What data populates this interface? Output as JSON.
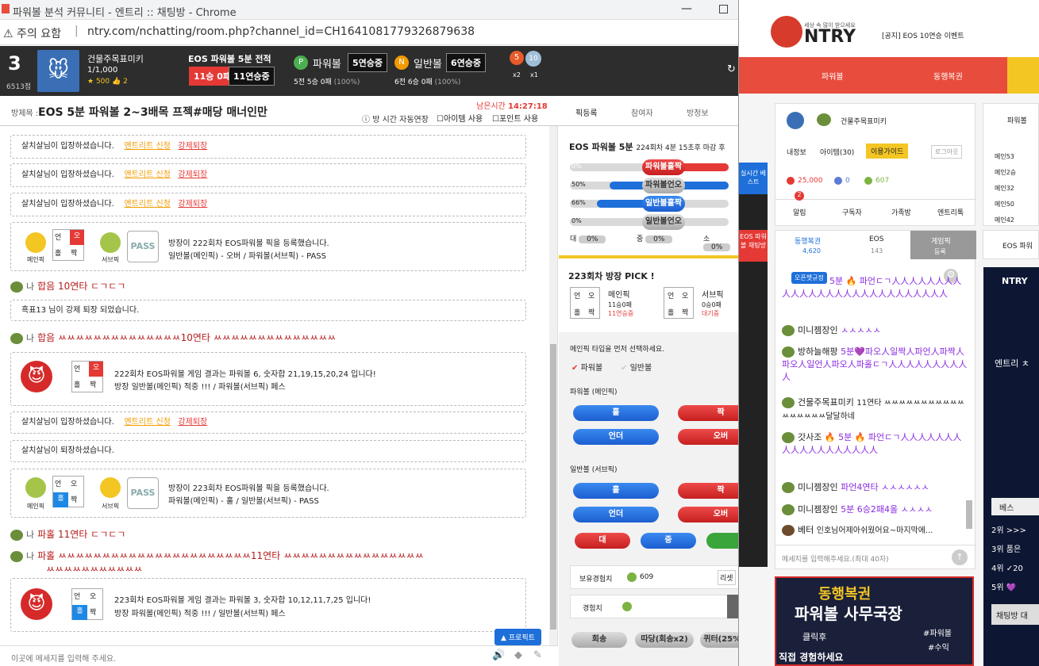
{
  "popup": {
    "window_title": "파워볼 분석 커뮤니티 - 엔트리 :: 채팅방 - Chrome",
    "warning": "주의 요함",
    "url": "ntry.com/nchatting/room.php?channel_id=CH1641081779326879638",
    "level": "3",
    "points": "6513점",
    "nickname": "건물주목표미키",
    "rank": "1/1,000",
    "stars": "500",
    "likes": "2",
    "record_title": "EOS 파워볼 5분 전적",
    "win_loss": "11승 0패",
    "streak": "11연승중",
    "pb_label": "파워볼",
    "pb_streak": "5연승중",
    "pb_sub": "5전 5승 0패",
    "pb_pct": "(100%)",
    "nb_label": "일반볼",
    "nb_streak": "6연승중",
    "nb_sub": "6전 6승 0패",
    "nb_pct": "(100%)",
    "medal1": "5",
    "medal1x": "x2",
    "medal2": "10",
    "medal2x": "x1",
    "room_label": "방제목 :",
    "room_title": "EOS 5분 파워볼 2~3배목 프젝#매당 매너인만",
    "remain_label": "남은시간",
    "remain_time": "14:27:18",
    "auto_ext": "방 시간 자동연장",
    "item_use": "아이템 사용",
    "point_use": "포인트 사용",
    "tabs": [
      "픽등록",
      "참여자",
      "방정보"
    ]
  },
  "chat": {
    "enter": "살치살님이 입장하셨습니다.",
    "entry_apply": "엔트리트 신청",
    "kick": "강제퇴장",
    "pick222": "방장이 222회차 EOS파워볼 픽을 등록했습니다.",
    "pick222_detail": "일반볼(메인픽) - 오버 / 파워볼(서브픽) - PASS",
    "main_pick": "메인픽",
    "sub_pick": "서브픽",
    "pass": "PASS",
    "powerball": "파워볼",
    "normalball": "일반볼",
    "me": "나",
    "msg1": "합음 10연타 ㄷㄱㄷㄱ",
    "kicked": "흑표13 님이 강제 퇴장 되었습니다.",
    "msg2": "합음 ㅆㅆㅆㅆㅆㅆㅆㅆㅆㅆㅆㅆㅆㅆ10연타 ㅆㅆㅆㅆㅆㅆㅆㅆㅆㅆㅆㅆㅆㅆ",
    "res222": "222회차 EOS파워볼 게임 결과는 파워볼 6, 숫자합 21,19,15,20,24 입니다!",
    "res222b": "방장 일반볼(메인픽) 적중 !!! / 파워볼(서브픽) 페스",
    "leave": "살치살님이 퇴장하셨습니다.",
    "pick223": "방장이 223회차 EOS파워볼 픽을 등록했습니다.",
    "pick223_detail": "파워볼(메인픽) - 홀 / 일반볼(서브픽) - PASS",
    "msg3": "파홀 11연타 ㄷㄱㄷㄱ",
    "msg4": "파홀 ㅆㅆㅆㅆㅆㅆㅆㅆㅆㅆㅆㅆㅆㅆㅆㅆㅆㅆㅆㅆㅆㅆ11연타 ㅆㅆㅆㅆㅆㅆㅆㅆㅆㅆㅆㅆㅆㅆㅆㅆ",
    "msg4b": "ㅆㅆㅆㅆㅆㅆㅆㅆㅆㅆㅆ",
    "res223": "223회차 EOS파워볼 게임 결과는 파워볼 3, 숫자합 10,12,11,7,25 입니다!",
    "res223b": "방장 파워볼(메인픽) 적중 !!! / 일반볼(서브픽) 페스",
    "c_un": "언",
    "c_o": "오",
    "c_hol": "홀",
    "c_jjak": "짝",
    "input_ph": "이곳에 메세지를 입력해 주세요.",
    "pro": "▲ 프로픽트"
  },
  "side": {
    "round": "EOS 파워볼 5분",
    "round_sub": "224회차 4분 15초후 마감 후",
    "b1": "파워볼홀짝",
    "b2": "파워볼언오",
    "b3": "일반볼홀짝",
    "b4": "일반볼언오",
    "p0": "0%",
    "p50": "50%",
    "p66": "66%",
    "sz": [
      "대",
      "중",
      "소"
    ],
    "pick_title": "223회차 방장 PICK !",
    "main": "메인픽",
    "main_rec": "11승0패",
    "main_streak": "11연승중",
    "sub": "서브픽",
    "sub_rec": "0승0패",
    "sub_wait": "대기중",
    "select_msg": "메인픽 타입을 먼저 선택하세요.",
    "pb": "파워볼",
    "nb": "일반볼",
    "pb_main": "파워볼 (메인픽)",
    "nb_sub": "일반볼 (서브픽)",
    "hol": "홀",
    "jjak": "짝",
    "under": "언더",
    "over": "오버",
    "dae": "대",
    "jung": "중",
    "exp_have": "보유경험치",
    "exp_val": "609",
    "exp": "경험치",
    "reset": "리셋",
    "btns": [
      "회송",
      "따당(회송x2)",
      "퀴터(25%)"
    ]
  },
  "main": {
    "brand_slogan": "세상 속 많이 받으세요",
    "brand": "NTRY",
    "notice": "[공지] EOS 10연승 이벤트",
    "nav": [
      "파워볼",
      "동행복권"
    ],
    "nick": "건물주목표미키",
    "info": "내정보",
    "item": "아이템(30)",
    "guide": "이용가이드",
    "logout": "로그아웃",
    "cash": "25,000",
    "p": "0",
    "e": "607",
    "menu": [
      "알림",
      "구독자",
      "가족방",
      "엔트리톡"
    ],
    "badge": "2",
    "tabs": [
      "동행복권",
      "EOS",
      "게임픽"
    ],
    "tab_sub": [
      "4,620",
      "143",
      "등록"
    ],
    "side_title": "파워볼",
    "side_users": [
      "메인53",
      "메인2승",
      "메인32",
      "메인50",
      "메인42"
    ],
    "best": "실시간 베스트",
    "eos_chat": "EOS 파워볼 채팅방",
    "open_rule": "오픈챗규정",
    "chat": [
      {
        "n": "",
        "t": "5분 🔥 파언ㄷㄱ人人人人人人人人人人人人人人人人人人人人人人人人人人人"
      },
      {
        "n": "미니젬장인",
        "t": "ㅅㅅㅅㅅㅅ"
      },
      {
        "n": "방하늘해팡",
        "t": "5분💜파오人일짝人파언人파짝人파오人일언人파오人파홀ㄷㄱ人人人人人人人人人人"
      },
      {
        "n": "건물주목표미키",
        "t": "11연타 ㅆㅆㅆㅆㅆㅆㅆㅆㅆㅆㅆㅆㅆㅆㅆㅆㅆ달달하네"
      },
      {
        "n": "갓사조",
        "t": "🔥 5분 🔥 파언ㄷㄱ人人人人人人人人人人人人人人人人人人"
      },
      {
        "n": "미니젬장인",
        "t": "파언4연타 ㅅㅅㅅㅅㅅㅅ"
      },
      {
        "n": "미니젬장인",
        "t": "5분 6승2패4올 ㅅㅅㅅㅅ"
      },
      {
        "n": "베터",
        "t": "인호님어제아쉬웠어요~마지막에..."
      }
    ],
    "input_ph": "메세지를 입력해주세요.(최대 40자)",
    "ad1": "동행복권",
    "ad2": "파워볼 사무국장",
    "ad3": "클릭후",
    "ad4": "직접 경험하세요",
    "ad5": "#파워볼",
    "ad6": "#수익",
    "rank": [
      "2위 >>>",
      "3위 품은",
      "4위 ✓20",
      "5위 💜"
    ],
    "more": "베스",
    "chat_btn": "채팅방 대",
    "entry": "엔트리 ㅊ",
    "eos_side": "EOS 파워"
  }
}
